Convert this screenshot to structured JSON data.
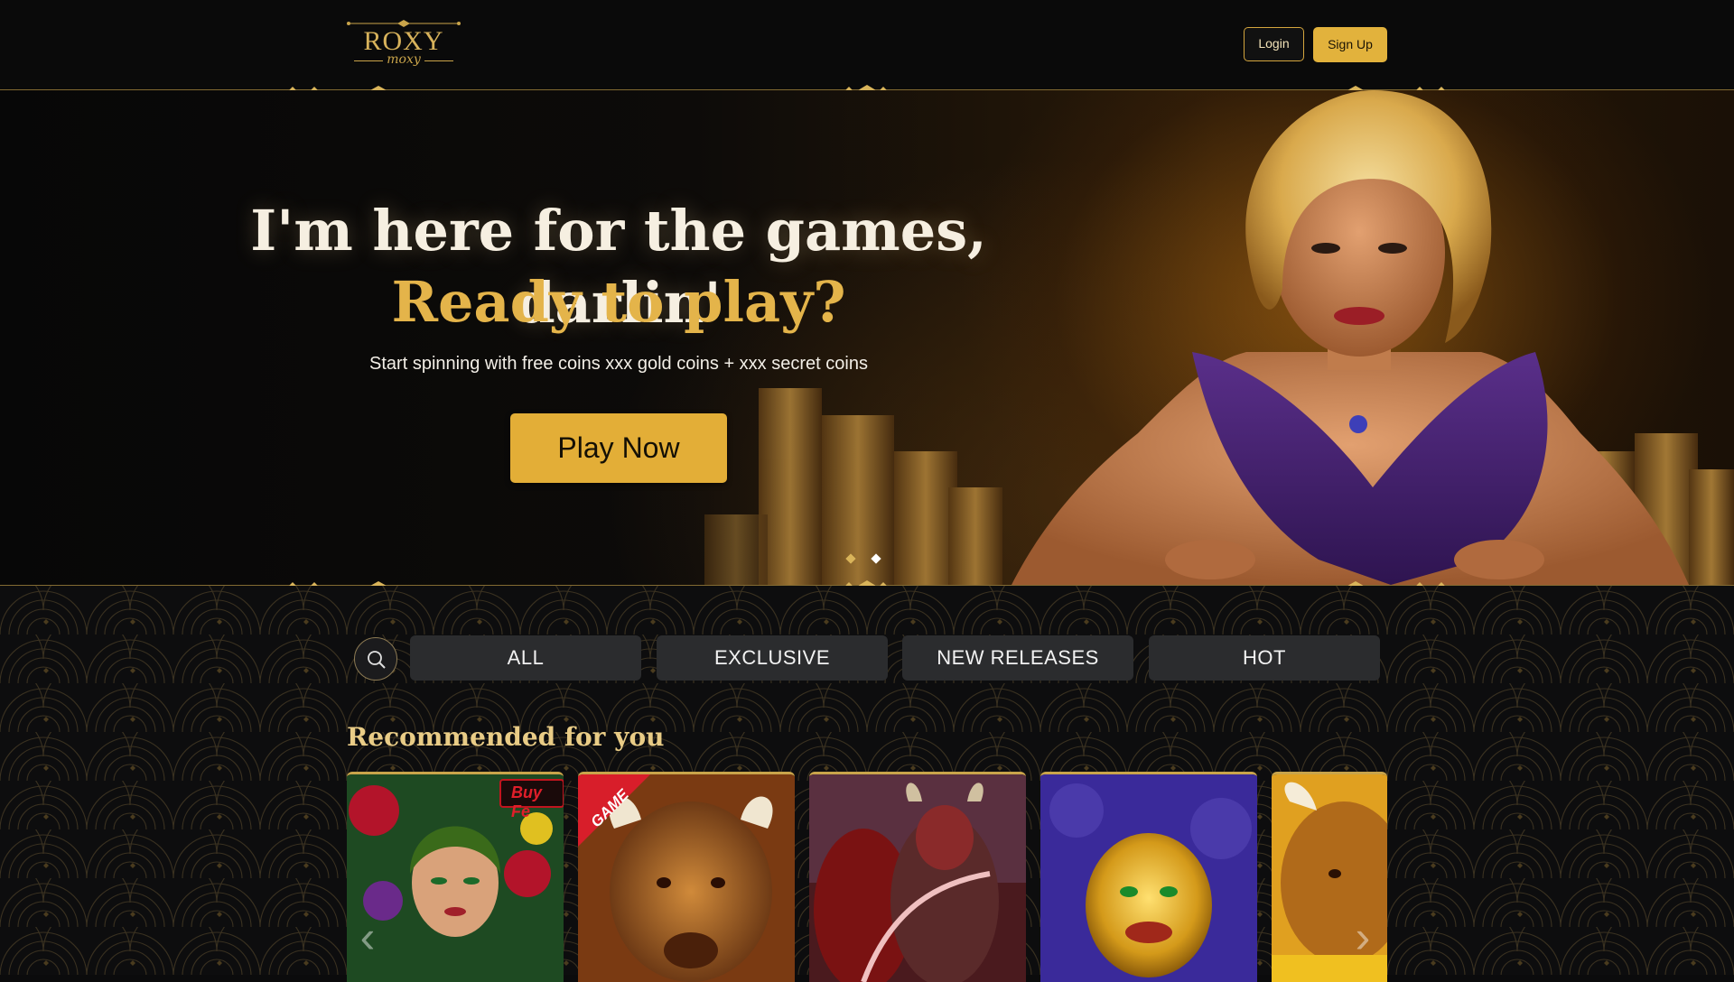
{
  "header": {
    "logo": {
      "main": "ROXY",
      "sub": "moxy"
    },
    "login_label": "Login",
    "signup_label": "Sign Up"
  },
  "hero": {
    "title": "I'm here for the games, darlin'",
    "subtitle": "Ready to play?",
    "description": "Start spinning with free coins xxx gold coins + xxx secret coins",
    "cta_label": "Play Now",
    "slide_count": 2,
    "active_slide": 2
  },
  "catalog": {
    "search_icon": "search-icon",
    "tabs": [
      {
        "label": "ALL"
      },
      {
        "label": "EXCLUSIVE"
      },
      {
        "label": "NEW RELEASES"
      },
      {
        "label": "HOT"
      }
    ],
    "section_title": "Recommended for you",
    "games": [
      {
        "badge": "Buy Fe"
      },
      {
        "badge": "GAME"
      },
      {
        "badge": ""
      },
      {
        "badge": ""
      },
      {
        "badge": ""
      }
    ],
    "prev_icon": "chevron-left-icon",
    "next_icon": "chevron-right-icon"
  },
  "colors": {
    "gold": "#e2b23c",
    "gold_text": "#e4b44a",
    "tab_bg": "#2b2c2e",
    "header_bg": "#0a0a0a"
  }
}
